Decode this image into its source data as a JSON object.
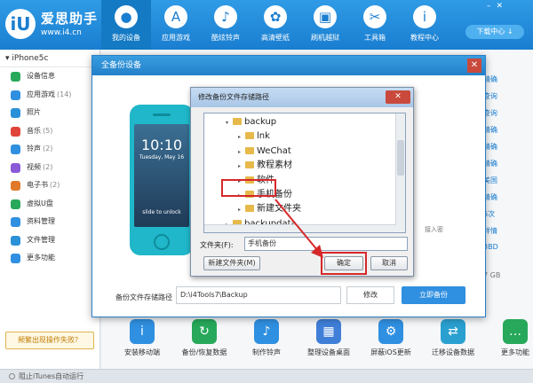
{
  "app": {
    "name": "爱思助手",
    "url": "www.i4.cn"
  },
  "topnav": [
    {
      "label": "我的设备",
      "icon": "apple-icon",
      "glyph": "",
      "active": true
    },
    {
      "label": "应用游戏",
      "icon": "app-store-icon",
      "glyph": "A"
    },
    {
      "label": "酷炫铃声",
      "icon": "bell-icon",
      "glyph": "♪"
    },
    {
      "label": "高清壁纸",
      "icon": "flower-icon",
      "glyph": "✿"
    },
    {
      "label": "刷机越狱",
      "icon": "box-icon",
      "glyph": "▣"
    },
    {
      "label": "工具箱",
      "icon": "tools-icon",
      "glyph": "✂"
    },
    {
      "label": "教程中心",
      "icon": "info-icon",
      "glyph": "i"
    }
  ],
  "download_center": "下载中心 ↓",
  "sidebar": {
    "device": "iPhone5c",
    "items": [
      {
        "label": "设备信息",
        "count": "",
        "color": "#27a85a"
      },
      {
        "label": "应用游戏",
        "count": "(14)",
        "color": "#2f8fe0"
      },
      {
        "label": "照片",
        "count": "",
        "color": "#2a90d8"
      },
      {
        "label": "音乐",
        "count": "(5)",
        "color": "#e0453a"
      },
      {
        "label": "铃声",
        "count": "(2)",
        "color": "#2f8fe0"
      },
      {
        "label": "视频",
        "count": "(2)",
        "color": "#8a5ad8"
      },
      {
        "label": "电子书",
        "count": "(2)",
        "color": "#e07a2a"
      },
      {
        "label": "虚拟U盘",
        "count": "",
        "color": "#27a85a"
      },
      {
        "label": "资料管理",
        "count": "",
        "color": "#2f8fe0"
      },
      {
        "label": "文件管理",
        "count": "",
        "color": "#2a90d8"
      },
      {
        "label": "更多功能",
        "count": "",
        "color": "#2f8fe0"
      }
    ],
    "feedback": "频繁出现操作失败？"
  },
  "right_values": [
    "精确",
    "查询",
    "查询",
    "精确",
    "精确",
    "精确",
    "美国",
    "精确",
    "6次",
    "详情",
    "8BD"
  ],
  "right_extra": "7 GB",
  "bottom_tools": [
    {
      "label": "安装移动端",
      "color": "#2f8fe0",
      "glyph": "i"
    },
    {
      "label": "备份/恢复数据",
      "color": "#27a85a",
      "glyph": "↻"
    },
    {
      "label": "制作铃声",
      "color": "#2f8fe0",
      "glyph": "♪"
    },
    {
      "label": "整理设备桌面",
      "color": "#3f7fd8",
      "glyph": "▦"
    },
    {
      "label": "屏蔽iOS更新",
      "color": "#2f8fe0",
      "glyph": "⚙"
    },
    {
      "label": "迁移设备数据",
      "color": "#2aa0d0",
      "glyph": "⇄"
    },
    {
      "label": "更多功能",
      "color": "#27a85a",
      "glyph": "…"
    }
  ],
  "statusbar": "阻止iTunes自动运行",
  "backup_dialog": {
    "title": "全备份设备",
    "path_label": "备份文件存储路径",
    "path_value": "D:\\i4Tools7\\Backup",
    "modify": "修改",
    "start": "立即备份",
    "hint": "接入密",
    "phone": {
      "time": "10:10",
      "date": "Tuesday, May 16",
      "slide": "slide to unlock"
    }
  },
  "folder_dialog": {
    "title": "修改备份文件存储路径",
    "tree": [
      {
        "label": "backup",
        "expanded": true
      },
      {
        "label": "lnk"
      },
      {
        "label": "WeChat"
      },
      {
        "label": "教程素材"
      },
      {
        "label": "软件"
      },
      {
        "label": "手机备份"
      },
      {
        "label": "新建文件夹"
      },
      {
        "label": "backupdata"
      }
    ],
    "filename_label": "文件夹(F):",
    "filename_value": "手机备份",
    "new_folder": "新建文件夹(M)",
    "ok": "确定",
    "cancel": "取消"
  }
}
